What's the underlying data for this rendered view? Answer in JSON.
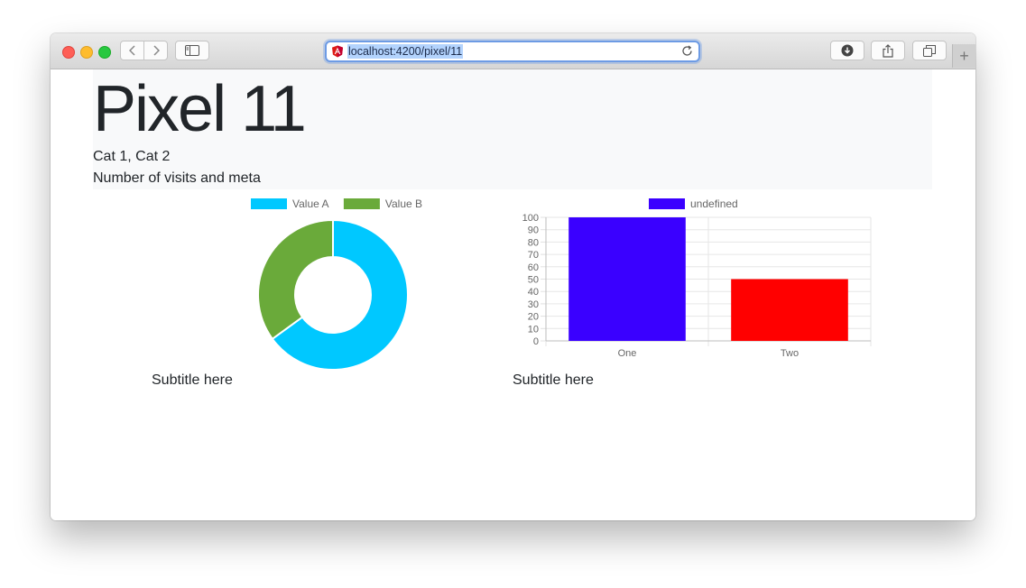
{
  "browser": {
    "url": "localhost:4200/pixel/11"
  },
  "page": {
    "title": "Pixel 11",
    "categories": "Cat 1, Cat 2",
    "description": "Number of visits and meta"
  },
  "charts": {
    "left_subtitle": "Subtitle here",
    "right_subtitle": "Subtitle here"
  },
  "colors": {
    "value_a": "#00c8ff",
    "value_b": "#6aaa3a",
    "bar_one": "#3a00ff",
    "bar_two": "#ff0000"
  },
  "chart_data": [
    {
      "type": "pie",
      "variant": "doughnut",
      "labels": [
        "Value A",
        "Value B"
      ],
      "values": [
        65,
        35
      ],
      "colors": [
        "#00c8ff",
        "#6aaa3a"
      ],
      "legend": "top"
    },
    {
      "type": "bar",
      "categories": [
        "One",
        "Two"
      ],
      "values": [
        100,
        50
      ],
      "colors": [
        "#3a00ff",
        "#ff0000"
      ],
      "legend_label": "undefined",
      "legend": "top",
      "ylim": [
        0,
        100
      ],
      "yticks": [
        0,
        10,
        20,
        30,
        40,
        50,
        60,
        70,
        80,
        90,
        100
      ],
      "grid": true
    }
  ]
}
